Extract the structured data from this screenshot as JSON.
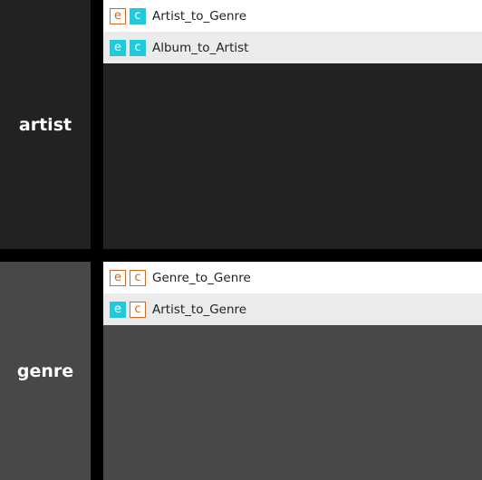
{
  "colors": {
    "active": "#1ecbdc",
    "inactive": "#d2691e"
  },
  "sections": [
    {
      "title": "artist",
      "bg": "#222222",
      "items": [
        {
          "e": {
            "label": "e",
            "active": false
          },
          "c": {
            "label": "c",
            "active": true
          },
          "name": "Artist_to_Genre"
        },
        {
          "e": {
            "label": "e",
            "active": true
          },
          "c": {
            "label": "c",
            "active": true
          },
          "name": "Album_to_Artist"
        }
      ]
    },
    {
      "title": "genre",
      "bg": "#484848",
      "items": [
        {
          "e": {
            "label": "e",
            "active": false
          },
          "c": {
            "label": "c",
            "active": false
          },
          "name": "Genre_to_Genre"
        },
        {
          "e": {
            "label": "e",
            "active": true
          },
          "c": {
            "label": "c",
            "active": false
          },
          "name": "Artist_to_Genre"
        }
      ]
    }
  ]
}
